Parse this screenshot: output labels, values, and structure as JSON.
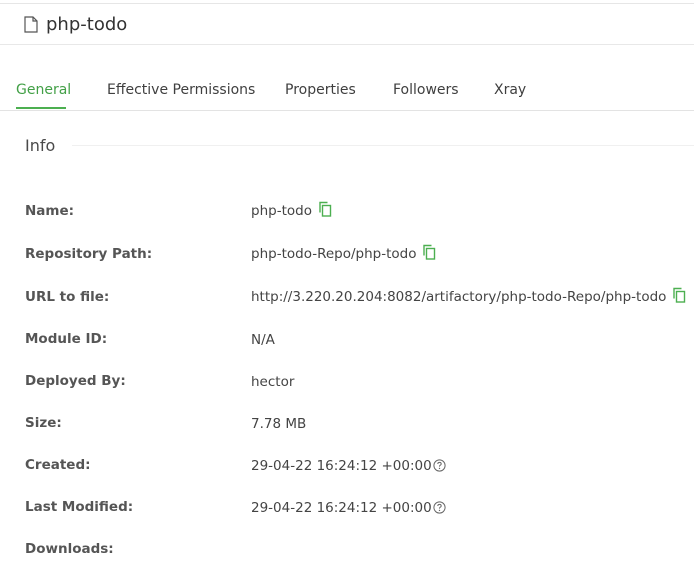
{
  "header": {
    "title": "php-todo",
    "icon": "file-icon"
  },
  "tabs": [
    {
      "label": "General",
      "active": true
    },
    {
      "label": "Effective Permissions",
      "active": false
    },
    {
      "label": "Properties",
      "active": false
    },
    {
      "label": "Followers",
      "active": false
    },
    {
      "label": "Xray",
      "active": false
    }
  ],
  "info": {
    "section_title": "Info",
    "rows": [
      {
        "label": "Name:",
        "value": "php-todo",
        "copyable": true
      },
      {
        "label": "Repository Path:",
        "value": "php-todo-Repo/php-todo",
        "copyable": true
      },
      {
        "label": "URL to file:",
        "value": "http://3.220.20.204:8082/artifactory/php-todo-Repo/php-todo",
        "copyable": true
      },
      {
        "label": "Module ID:",
        "value": "N/A",
        "copyable": false
      },
      {
        "label": "Deployed By:",
        "value": "hector",
        "copyable": false
      },
      {
        "label": "Size:",
        "value": "7.78 MB",
        "copyable": false
      },
      {
        "label": "Created:",
        "value": "29-04-22 16:24:12 +00:00",
        "copyable": false,
        "help": true
      },
      {
        "label": "Last Modified:",
        "value": "29-04-22 16:24:12 +00:00",
        "copyable": false,
        "help": true
      },
      {
        "label": "Downloads:",
        "value": "",
        "copyable": false
      }
    ]
  },
  "colors": {
    "accent": "#43a047",
    "copy_icon": "#4caf50"
  }
}
